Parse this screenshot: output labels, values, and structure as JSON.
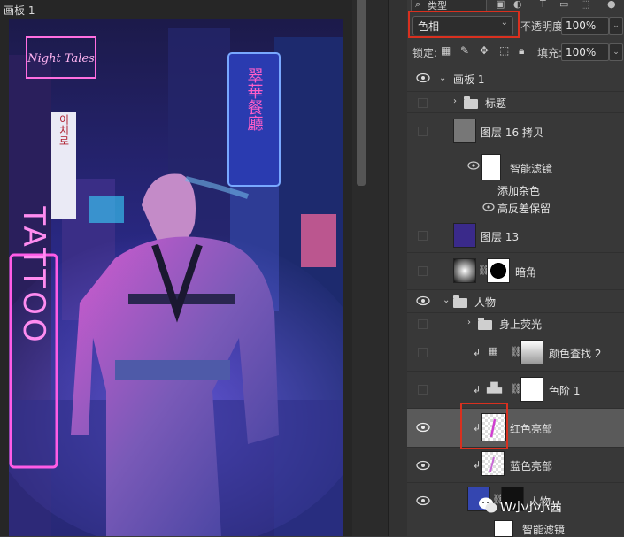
{
  "canvas": {
    "artboard_label": "画板 1",
    "signs": {
      "top_left": "Night Tales",
      "hanja_right": "翠華餐廳",
      "vertical_left": "TATTOO",
      "korean_left": "이치로"
    }
  },
  "panel": {
    "filter_label": "类型",
    "blend_mode": "色相",
    "opacity_label": "不透明度:",
    "opacity_value": "100%",
    "lock_label": "锁定:",
    "fill_label": "填充:",
    "fill_value": "100%"
  },
  "layers": [
    {
      "name": "画板 1",
      "visible": true
    },
    {
      "name": "标题",
      "visible": false
    },
    {
      "name": "图层 16 拷贝",
      "visible": false
    },
    {
      "name": "智能滤镜",
      "visible": true
    },
    {
      "name": "添加杂色"
    },
    {
      "name": "高反差保留",
      "visible": true
    },
    {
      "name": "图层 13",
      "visible": false
    },
    {
      "name": "暗角",
      "visible": false
    },
    {
      "name": "人物",
      "visible": true
    },
    {
      "name": "身上荧光",
      "visible": false
    },
    {
      "name": "颜色查找 2",
      "visible": false
    },
    {
      "name": "色阶 1",
      "visible": false
    },
    {
      "name": "红色亮部",
      "visible": true,
      "selected": true
    },
    {
      "name": "蓝色亮部",
      "visible": true
    },
    {
      "name": "人物",
      "visible": true
    },
    {
      "name": "智能滤镜",
      "visible": false
    }
  ],
  "watermark": "W小小小茜",
  "colors": {
    "highlight": "#d9301f",
    "panel_bg": "#383838",
    "selected_row": "#5a5a5a"
  }
}
